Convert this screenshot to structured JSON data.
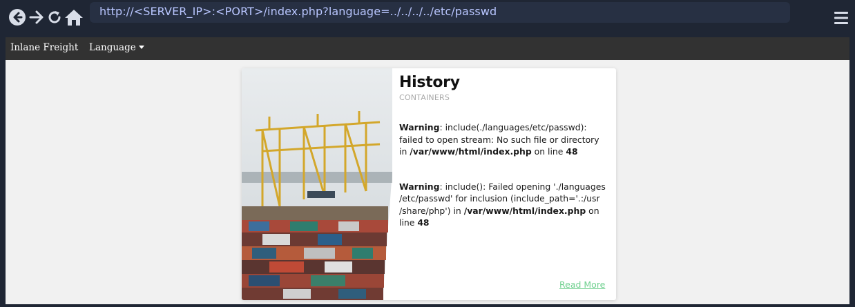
{
  "browser": {
    "url": "http://<SERVER_IP>:<PORT>/index.php?language=../../../../etc/passwd"
  },
  "navbar": {
    "brand": "Inlane Freight",
    "language_label": "Language"
  },
  "card": {
    "title": "History",
    "subtitle": "CONTAINERS",
    "warnings": [
      {
        "label": "Warning",
        "message": ": include(./languages/etc/passwd): failed to open stream: No such file or directory in ",
        "file": "/var/www/html/index.php",
        "on_line": " on line ",
        "line": "48"
      },
      {
        "label": "Warning",
        "message": ": include(): Failed opening './languages /etc/passwd' for inclusion (include_path='.:/usr /share/php') in ",
        "file": "/var/www/html/index.php",
        "on_line": " on line ",
        "line": "48"
      }
    ],
    "read_more": "Read More"
  },
  "colors": {
    "chrome_bg": "#1f2634",
    "url_bar_bg": "#273043",
    "url_text": "#b9c6ff",
    "navbar_bg": "#323232",
    "page_bg": "#f1f1f1",
    "link": "#6fd08f"
  }
}
